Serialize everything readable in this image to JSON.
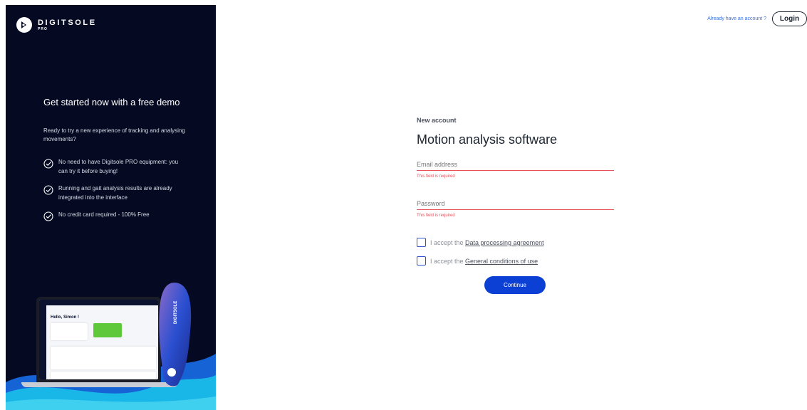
{
  "brand": {
    "name": "DIGITSOLE",
    "sub": "PRO"
  },
  "promo": {
    "headline": "Get started now with a free demo",
    "intro": "Ready to try a new experience of tracking and analysing movements?",
    "benefits": [
      "No need to have Digitsole PRO equipment: you can try it before buying!",
      "Running and gait analysis results are already integrated into the interface",
      "No credit card required - 100% Free"
    ],
    "illustration": {
      "greeting": "Hello, Simon !",
      "insole_brand": "DIGITSOLE"
    }
  },
  "header": {
    "already_text": "Already have an account ?",
    "login_label": "Login"
  },
  "form": {
    "eyebrow": "New account",
    "title": "Motion analysis software",
    "email_placeholder": "Email address",
    "email_error": "This field is required",
    "password_placeholder": "Password",
    "password_error": "This field is required",
    "accept_prefix_1": "I accept the ",
    "accept_link_1": "Data processing agreement",
    "accept_prefix_2": "I accept the ",
    "accept_link_2": "General conditions of use",
    "continue_label": "Continue"
  },
  "colors": {
    "panel_bg": "#050a22",
    "accent_blue": "#0c3fd4",
    "error_red": "#e8505b",
    "link_blue": "#3a6fd8"
  }
}
